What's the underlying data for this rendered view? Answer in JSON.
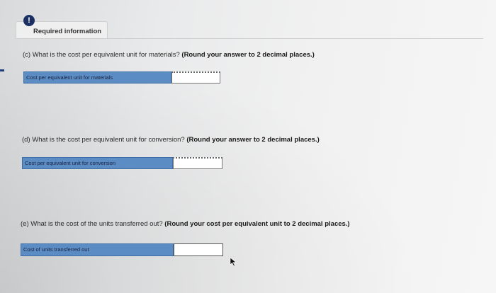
{
  "tab": {
    "icon": "info-icon",
    "icon_glyph": "!",
    "label": "Required information"
  },
  "questions": [
    {
      "id": "c",
      "text": "(c) What is the cost per equivalent unit for materials?",
      "emphasis": "(Round your answer to 2 decimal places.)",
      "field_label": "Cost per equivalent unit for materials",
      "value": ""
    },
    {
      "id": "d",
      "text": "(d) What is the cost per equivalent unit for conversion?",
      "emphasis": "(Round your answer to 2 decimal places.)",
      "field_label": "Cost per equivalent unit for conversion",
      "value": ""
    },
    {
      "id": "e",
      "text": "(e) What is the cost of the units transferred out?",
      "emphasis": "(Round your cost per equivalent unit to 2 decimal places.)",
      "field_label": "Cost of units transferred out",
      "value": ""
    }
  ],
  "colors": {
    "label_bg": "#5b8cc4",
    "icon_bg": "#1c2f63"
  }
}
